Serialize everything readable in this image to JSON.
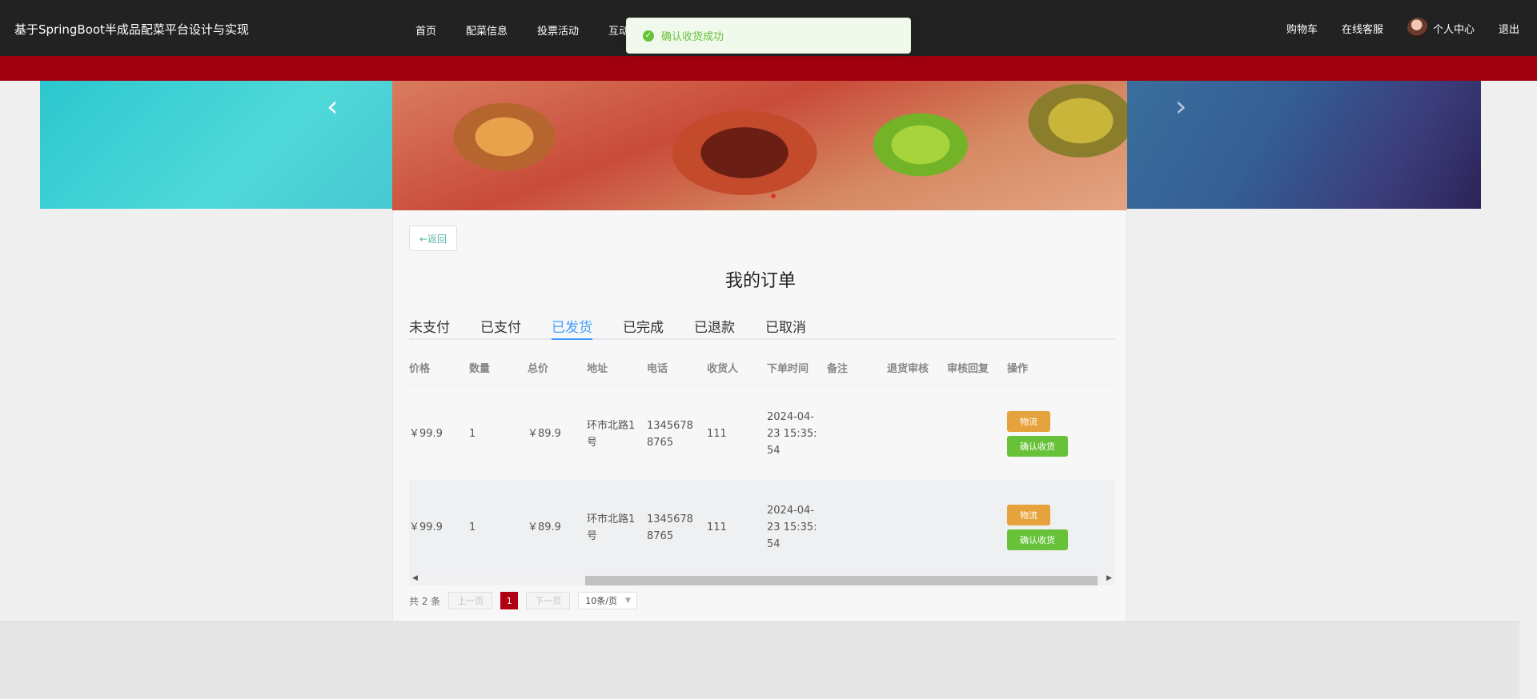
{
  "header": {
    "site_title": "基于SpringBoot半成品配菜平台设计与实现",
    "nav": [
      "首页",
      "配菜信息",
      "投票活动",
      "互动"
    ],
    "cart": "购物车",
    "service": "在线客服",
    "user_center": "个人中心",
    "logout": "退出"
  },
  "toast": {
    "message": "确认收货成功",
    "icon": "check-circle-icon",
    "color": "#67c23a"
  },
  "banner": {
    "prev": "‹",
    "next": "›"
  },
  "panel": {
    "back": "←返回",
    "title": "我的订单",
    "tabs": [
      "未支付",
      "已支付",
      "已发货",
      "已完成",
      "已退款",
      "已取消"
    ],
    "active_tab": "已发货"
  },
  "table": {
    "columns": [
      "价格",
      "数量",
      "总价",
      "地址",
      "电话",
      "收货人",
      "下单时间",
      "备注",
      "退货审核",
      "审核回复",
      "操作"
    ],
    "rows": [
      {
        "price": "￥99.9",
        "qty": "1",
        "total": "￥89.9",
        "address": "环市北路1号",
        "phone": "13456788765",
        "receiver": "111",
        "time": "2024-04-23 15:35:54",
        "note": "",
        "refund": "",
        "reply": "",
        "op_logistics": "物流",
        "op_confirm": "确认收货"
      },
      {
        "price": "￥99.9",
        "qty": "1",
        "total": "￥89.9",
        "address": "环市北路1号",
        "phone": "13456788765",
        "receiver": "111",
        "time": "2024-04-23 15:35:54",
        "note": "",
        "refund": "",
        "reply": "",
        "op_logistics": "物流",
        "op_confirm": "确认收货"
      }
    ]
  },
  "pagination": {
    "total": "共 2 条",
    "prev": "上一页",
    "page": "1",
    "next": "下一页",
    "size": "10条/页"
  },
  "colors": {
    "topbar": "#222222",
    "redbar": "#a0000d",
    "success": "#67c23a",
    "warning": "#e6a23c",
    "tab_active": "#409eff"
  }
}
